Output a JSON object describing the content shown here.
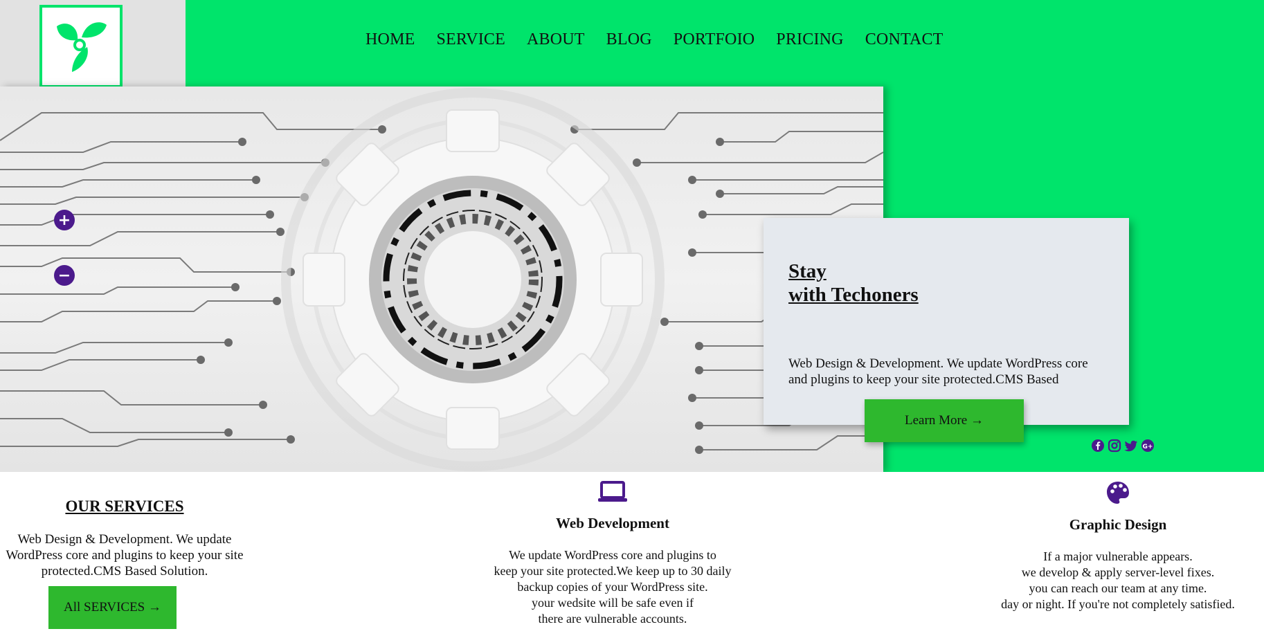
{
  "nav": {
    "items": [
      "HOME",
      "SERVICE",
      "ABOUT",
      "BLOG",
      "PORTFOIO",
      "PRICING",
      "CONTACT"
    ]
  },
  "logo": {
    "icon": "leaf-logo-icon",
    "color": "#00e46b"
  },
  "hero": {
    "zoom_in": "+",
    "zoom_out": "−",
    "card": {
      "title_line1": "Stay",
      "title_line2": "with Techoners",
      "text": "Web Design & Development. We update WordPress core and plugins to keep your site protected.CMS Based"
    },
    "cta_label": "Learn More →"
  },
  "social": [
    "facebook-icon",
    "instagram-icon",
    "twitter-icon",
    "google-plus-icon"
  ],
  "services": {
    "heading": "OUR SERVICES",
    "intro": "Web Design & Development. We update WordPress core and plugins to keep your site protected.CMS Based Solution.",
    "all_label": "All SERVICES →",
    "items": [
      {
        "icon": "laptop-icon",
        "title": "Web Development",
        "lines": [
          "We update WordPress core and plugins to",
          "keep your site protected.We keep up to 30 daily",
          "backup copies of your WordPress site.",
          "your wedsite will be safe even if",
          "there are vulnerable accounts."
        ]
      },
      {
        "icon": "palette-icon",
        "title": "Graphic Design",
        "lines": [
          "If a major vulnerable appears.",
          "we develop & apply server-level fixes.",
          "you can reach our team at any time.",
          "day or night. If you're not completely satisfied."
        ]
      }
    ]
  },
  "colors": {
    "brand_green": "#00e46b",
    "button_green": "#2eb82e",
    "accent_purple": "#4b1a8c",
    "card_bg": "#e5e9ee"
  }
}
